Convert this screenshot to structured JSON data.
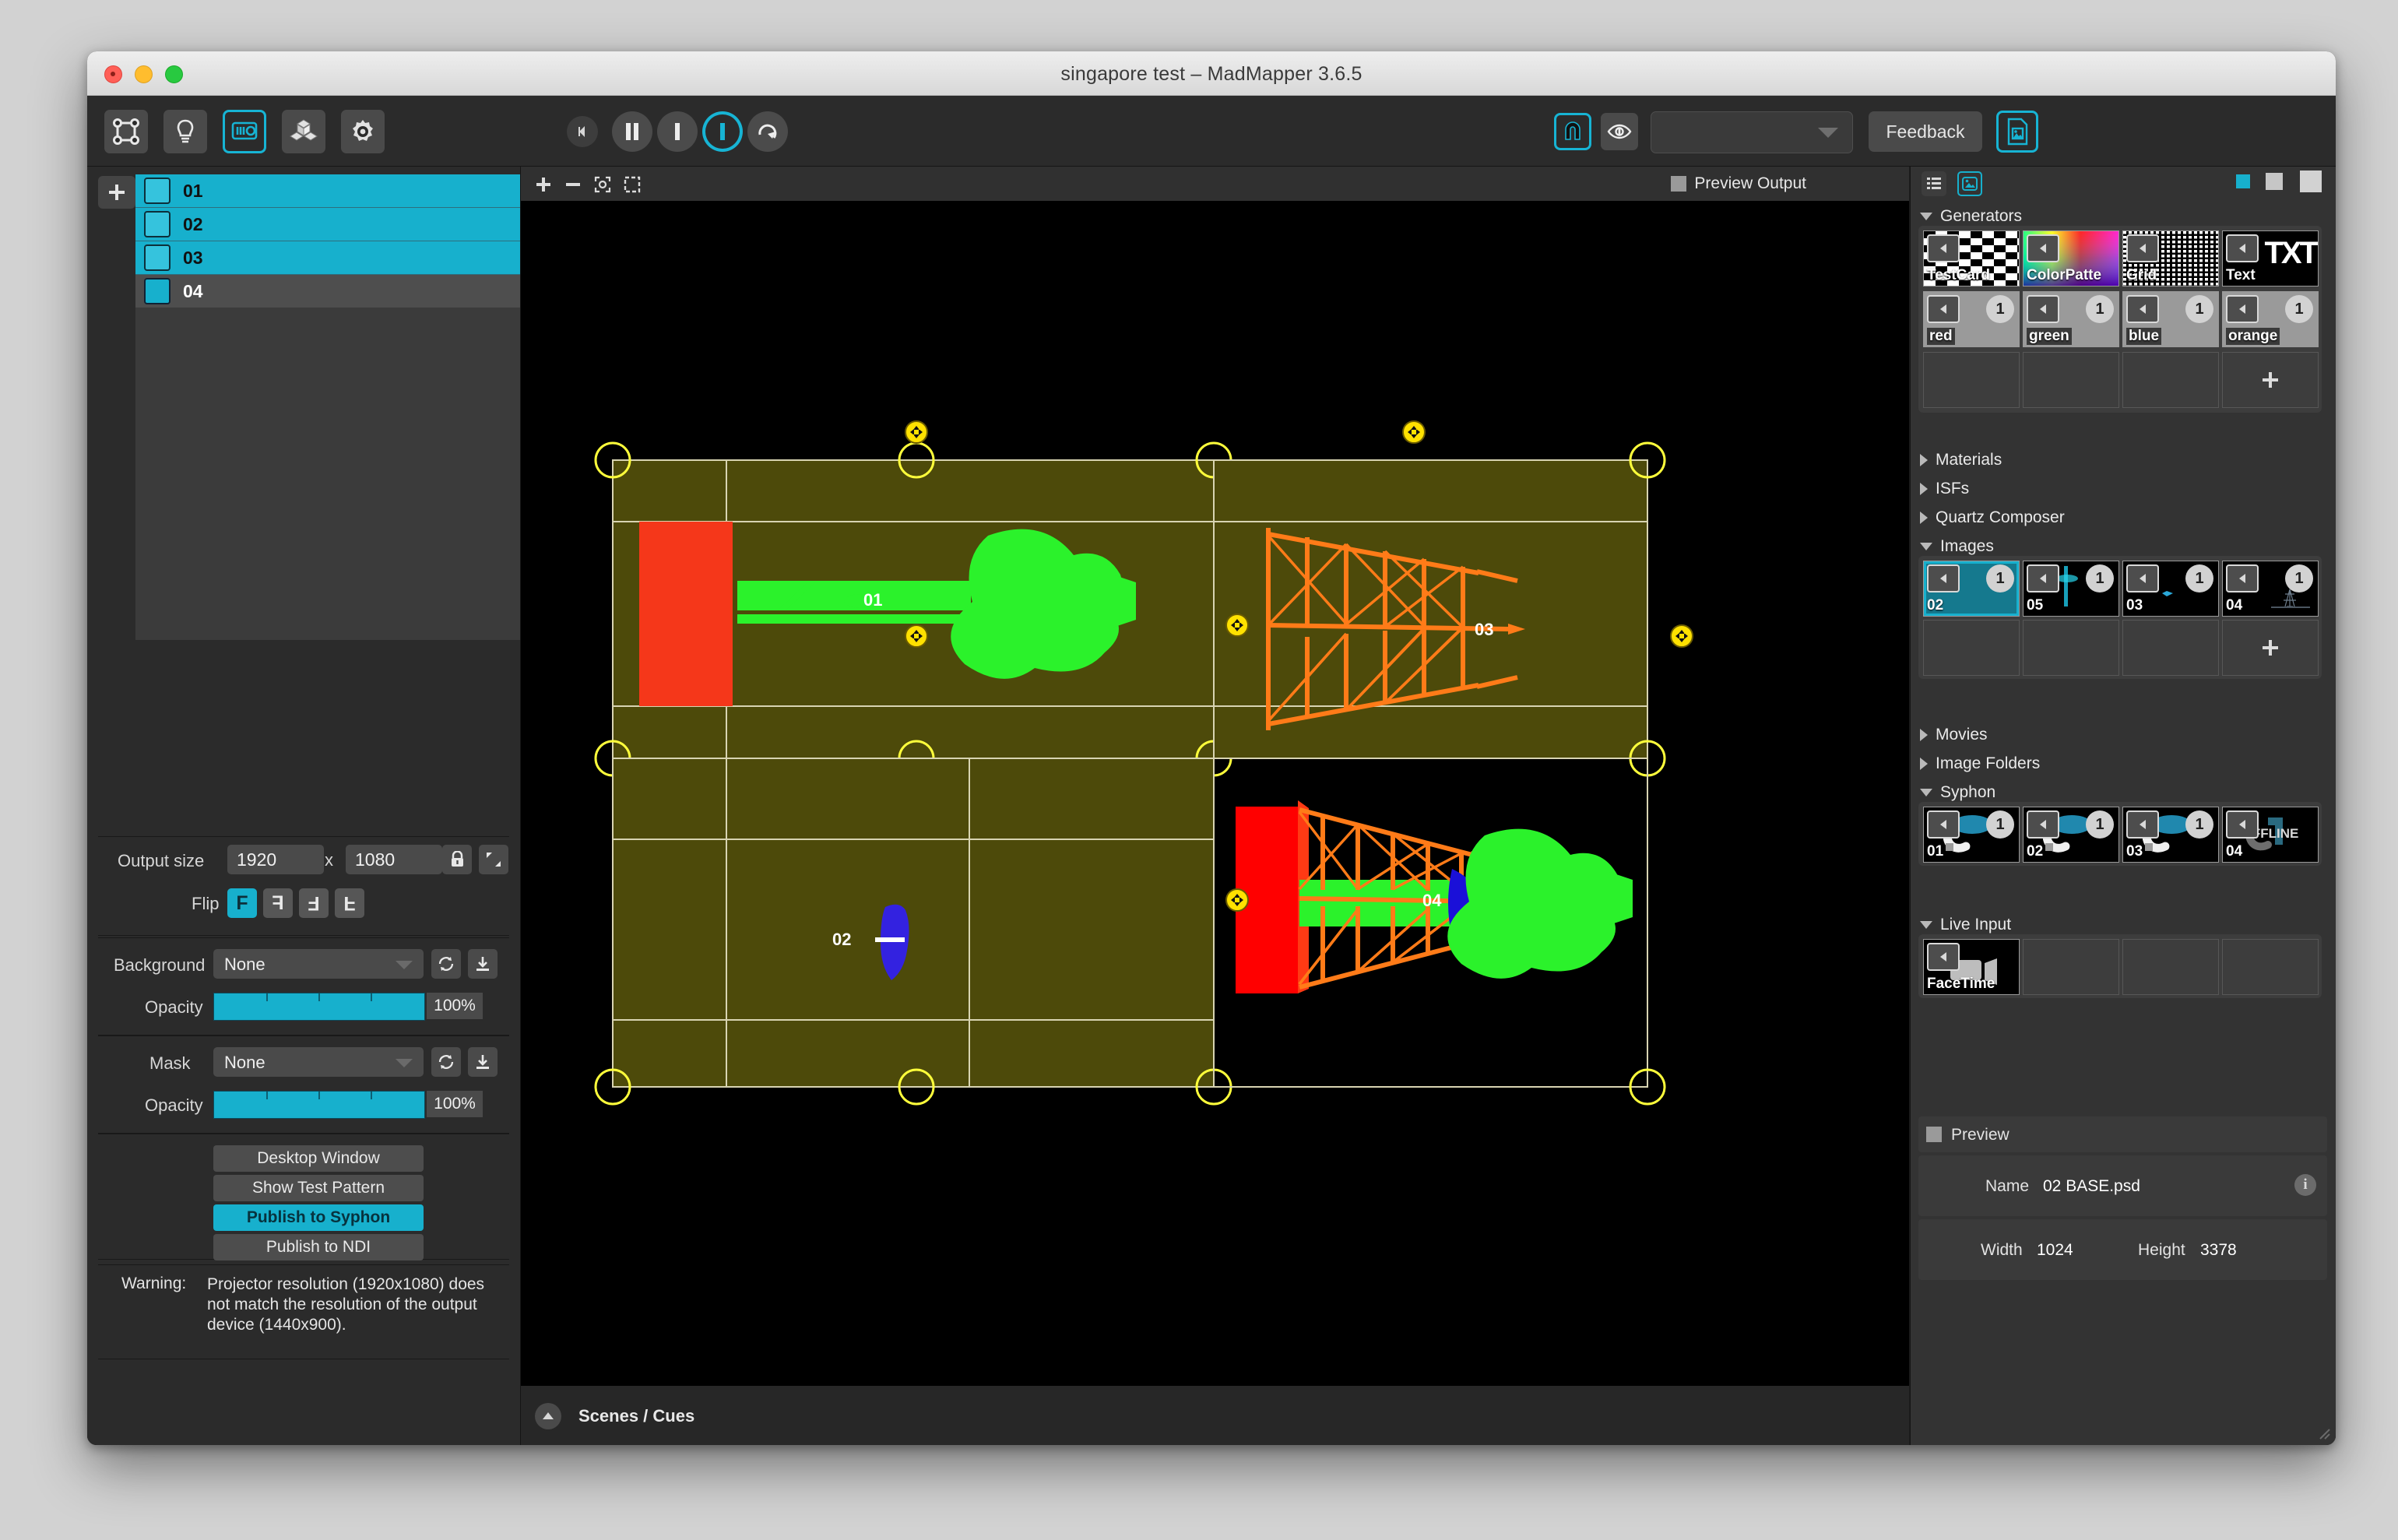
{
  "window": {
    "title": "singapore test – MadMapper 3.6.5",
    "traffic": [
      "close",
      "minimize",
      "zoom"
    ]
  },
  "toolbar": {
    "left_tools": [
      {
        "name": "surfaces-icon",
        "label": "Surfaces"
      },
      {
        "name": "lights-icon",
        "label": "Lights"
      },
      {
        "name": "media-icon",
        "label": "Media",
        "active": true
      },
      {
        "name": "modules-icon",
        "label": "Modules"
      },
      {
        "name": "preferences-icon",
        "label": "Preferences"
      }
    ],
    "collapse_label": "Collapse",
    "transport": [
      {
        "name": "pause-button",
        "label": "Pause"
      },
      {
        "name": "bpm-button",
        "label": "Beat"
      },
      {
        "name": "sync-button",
        "label": "Sync",
        "active": true
      },
      {
        "name": "resync-button",
        "label": "Resync"
      }
    ],
    "magnet_label": "Snap",
    "eye_label": "Preview visibility",
    "select_value": "",
    "select_placeholder": "",
    "feedback_label": "Feedback",
    "media_doc_label": "Media browser"
  },
  "left_panel": {
    "add_layer_label": "+",
    "layers": [
      {
        "name": "01",
        "selected": true,
        "enabled": true
      },
      {
        "name": "02",
        "selected": true,
        "enabled": true
      },
      {
        "name": "03",
        "selected": true,
        "enabled": true
      },
      {
        "name": "04",
        "selected": false,
        "enabled": true
      }
    ],
    "output": {
      "label": "Output size",
      "width": "1920",
      "separator": "x",
      "height": "1080",
      "lock_label": "Lock aspect ratio",
      "fit_label": "Fit"
    },
    "flip": {
      "label": "Flip",
      "options": [
        {
          "glyph": "F",
          "name": "flip-none",
          "active": true
        },
        {
          "glyph": "F",
          "name": "flip-horizontal",
          "active": false
        },
        {
          "glyph": "F",
          "name": "flip-vertical",
          "active": false
        },
        {
          "glyph": "F",
          "name": "flip-both",
          "active": false
        }
      ]
    },
    "background": {
      "label": "Background",
      "value": "None",
      "opacity_label": "Opacity",
      "opacity_value": "100%",
      "opacity_pct": 100,
      "refresh_label": "Refresh",
      "load_label": "Load"
    },
    "mask": {
      "label": "Mask",
      "value": "None",
      "opacity_label": "Opacity",
      "opacity_value": "100%",
      "opacity_pct": 100,
      "refresh_label": "Refresh",
      "load_label": "Load"
    },
    "actions": [
      {
        "label": "Desktop Window",
        "active": false
      },
      {
        "label": "Show Test Pattern",
        "active": false
      },
      {
        "label": "Publish to Syphon",
        "active": true
      },
      {
        "label": "Publish to NDI",
        "active": false
      }
    ],
    "warning": {
      "label": "Warning:",
      "text": "Projector resolution (1920x1080) does not match the resolution of the output device (1440x900)."
    }
  },
  "canvas": {
    "tools": [
      {
        "name": "add-surface-icon",
        "label": "+"
      },
      {
        "name": "remove-surface-icon",
        "label": "–"
      },
      {
        "name": "fit-view-icon",
        "label": "Fit"
      },
      {
        "name": "select-region-icon",
        "label": "Select"
      }
    ],
    "preview_output_label": "Preview Output",
    "list-view_label": "List view",
    "surfaces": [
      {
        "id": "01",
        "label": "01"
      },
      {
        "id": "02",
        "label": "02"
      },
      {
        "id": "03",
        "label": "03"
      },
      {
        "id": "04",
        "label": "04"
      }
    ],
    "bottom": {
      "scenes_label": "Scenes / Cues"
    }
  },
  "right_panel": {
    "view_list_label": "List view",
    "view_grid_label": "Thumbnail view",
    "size_small_label": "Small thumbnails",
    "size_medium_label": "Medium thumbnails",
    "size_large_label": "Large thumbnails",
    "sections": [
      {
        "name": "Generators",
        "open": true,
        "items": [
          {
            "label": "TestCard",
            "kind": "checker",
            "badge": null
          },
          {
            "label": "ColorPatte",
            "kind": "colorwheel",
            "badge": null
          },
          {
            "label": "Grid",
            "kind": "grid",
            "badge": null
          },
          {
            "label": "Text",
            "kind": "text",
            "badge": null
          },
          {
            "label": "red",
            "kind": "solid",
            "badge": "1"
          },
          {
            "label": "green",
            "kind": "solid",
            "badge": "1"
          },
          {
            "label": "blue",
            "kind": "solid",
            "badge": "1"
          },
          {
            "label": "orange",
            "kind": "solid",
            "badge": "1"
          },
          {
            "label": "",
            "kind": "empty",
            "badge": null
          },
          {
            "label": "",
            "kind": "empty",
            "badge": null
          },
          {
            "label": "",
            "kind": "empty",
            "badge": null
          },
          {
            "label": "",
            "kind": "plus",
            "badge": null
          }
        ]
      },
      {
        "name": "Materials",
        "open": false,
        "items": []
      },
      {
        "name": "ISFs",
        "open": false,
        "items": []
      },
      {
        "name": "Quartz Composer",
        "open": false,
        "items": []
      },
      {
        "name": "Images",
        "open": true,
        "items": [
          {
            "label": "02",
            "kind": "image",
            "badge": "1",
            "selected": true
          },
          {
            "label": "05",
            "kind": "image",
            "badge": "1"
          },
          {
            "label": "03",
            "kind": "image",
            "badge": "1"
          },
          {
            "label": "04",
            "kind": "image",
            "badge": "1"
          },
          {
            "label": "",
            "kind": "empty",
            "badge": null
          },
          {
            "label": "",
            "kind": "empty",
            "badge": null
          },
          {
            "label": "",
            "kind": "empty",
            "badge": null
          },
          {
            "label": "",
            "kind": "plus",
            "badge": null
          }
        ]
      },
      {
        "name": "Movies",
        "open": false,
        "items": []
      },
      {
        "name": "Image Folders",
        "open": false,
        "items": []
      },
      {
        "name": "Syphon",
        "open": true,
        "items": [
          {
            "label": "01",
            "kind": "syphon",
            "badge": "1"
          },
          {
            "label": "02",
            "kind": "syphon",
            "badge": "1"
          },
          {
            "label": "03",
            "kind": "syphon",
            "badge": "1"
          },
          {
            "label": "04",
            "kind": "syphon-offline",
            "badge": null,
            "overlay": "OFFLINE"
          }
        ]
      },
      {
        "name": "Live Input",
        "open": true,
        "items": [
          {
            "label": "FaceTime",
            "kind": "camera",
            "badge": null
          },
          {
            "label": "",
            "kind": "empty",
            "badge": null
          },
          {
            "label": "",
            "kind": "empty",
            "badge": null
          },
          {
            "label": "",
            "kind": "empty",
            "badge": null
          }
        ]
      }
    ],
    "preview": {
      "header_label": "Preview",
      "name_label": "Name",
      "name_value": "02 BASE.psd",
      "width_label": "Width",
      "width_value": "1024",
      "height_label": "Height",
      "height_value": "3378",
      "info_label": "i"
    }
  },
  "colors": {
    "accent": "#17b0cd",
    "panel": "#2b2b2b",
    "panel_right": "#333333",
    "canvas": "#000000",
    "surface_fill": "#4d4a0a",
    "handle": "#ffff3b",
    "red": "#f5371a",
    "green": "#2bf22b",
    "blue": "#3322e0",
    "orange": "#ff7b18"
  }
}
